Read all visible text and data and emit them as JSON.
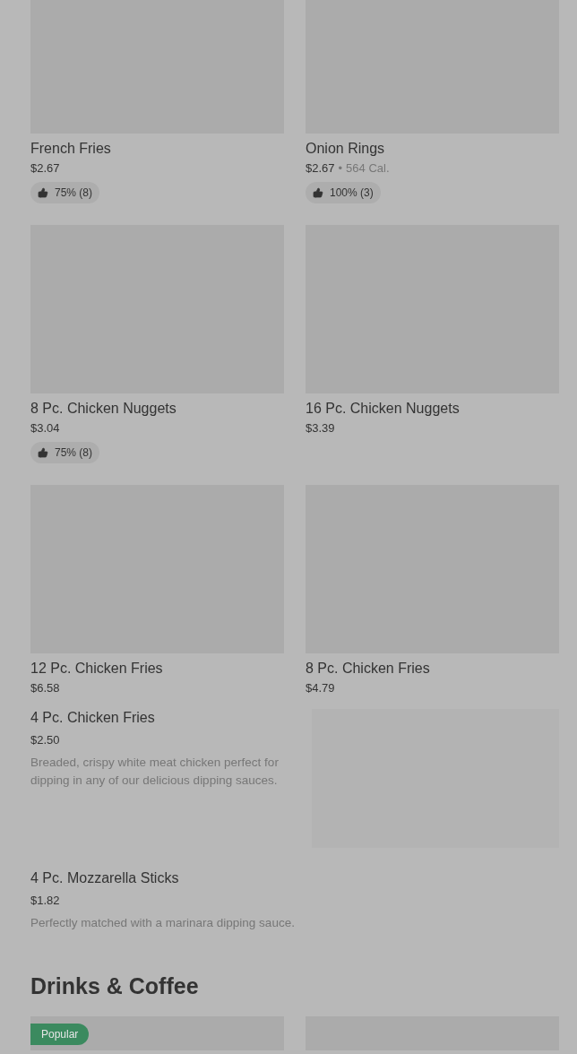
{
  "grid_items": [
    {
      "name": "French Fries",
      "price": "$2.67",
      "rating": "75% (8)"
    },
    {
      "name": "Onion Rings",
      "price": "$2.67",
      "separator": "•",
      "calories": "564 Cal.",
      "rating": "100% (3)"
    },
    {
      "name": "8 Pc. Chicken Nuggets",
      "price": "$3.04",
      "rating": "75% (8)"
    },
    {
      "name": "16 Pc. Chicken Nuggets",
      "price": "$3.39"
    },
    {
      "name": "12 Pc. Chicken Fries",
      "price": "$6.58"
    },
    {
      "name": "8 Pc. Chicken Fries",
      "price": "$4.79"
    }
  ],
  "list_items": [
    {
      "kind": "with-image",
      "name": "4 Pc. Chicken Fries",
      "price": "$2.50",
      "description": "Breaded, crispy white meat chicken perfect for dipping in any of our delicious dipping sauces."
    },
    {
      "kind": "text-only",
      "name": "4 Pc. Mozzarella Sticks",
      "price": "$1.82",
      "description": "Perfectly matched with a marinara dipping sauce."
    }
  ],
  "section": {
    "title": "Drinks & Coffee",
    "items": [
      {
        "kind": "badged",
        "badge": "Popular"
      },
      {
        "kind": "plain"
      }
    ]
  }
}
